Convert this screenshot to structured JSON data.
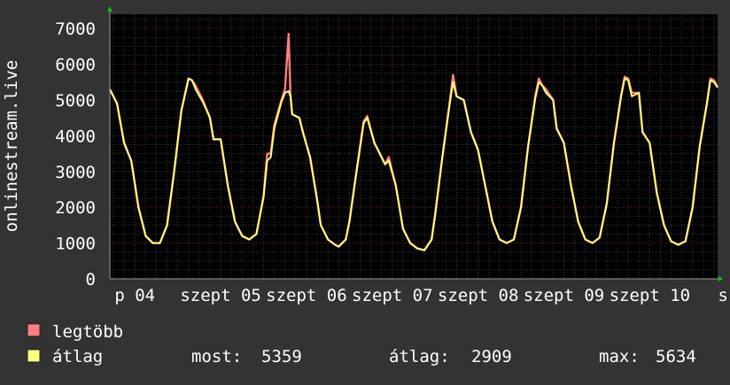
{
  "chart_data": {
    "type": "line",
    "title": "",
    "ylabel": "onlinestream.live",
    "xlabel": "",
    "ylim": [
      0,
      7400
    ],
    "xlim": [
      0,
      170
    ],
    "x_unit_note": "hours since start of window (p 04 00:00 at x=7)",
    "yticks": [
      0,
      1000,
      2000,
      3000,
      4000,
      5000,
      6000,
      7000
    ],
    "x_tick_labels": [
      {
        "x": 7,
        "label": "p 04"
      },
      {
        "x": 31,
        "label": "szept 05"
      },
      {
        "x": 55,
        "label": "szept 06"
      },
      {
        "x": 79,
        "label": "szept 07"
      },
      {
        "x": 103,
        "label": "szept 08"
      },
      {
        "x": 127,
        "label": "szept 09"
      },
      {
        "x": 151,
        "label": "szept 10"
      },
      {
        "x": 175,
        "label": "s"
      }
    ],
    "grid": true,
    "legend_position": "bottom-left",
    "series": [
      {
        "name": "legtöbb",
        "color": "#ff7f7f",
        "points": [
          [
            0,
            5300
          ],
          [
            2,
            4900
          ],
          [
            4,
            3800
          ],
          [
            6,
            3300
          ],
          [
            8,
            2000
          ],
          [
            10,
            1200
          ],
          [
            12,
            1000
          ],
          [
            14,
            1000
          ],
          [
            16,
            1500
          ],
          [
            18,
            3000
          ],
          [
            20,
            4700
          ],
          [
            22,
            5600
          ],
          [
            23,
            5550
          ],
          [
            24,
            5400
          ],
          [
            26,
            5000
          ],
          [
            28,
            4500
          ],
          [
            29,
            3900
          ],
          [
            31,
            3900
          ],
          [
            33,
            2600
          ],
          [
            35,
            1600
          ],
          [
            37,
            1200
          ],
          [
            39,
            1100
          ],
          [
            41,
            1250
          ],
          [
            43,
            2300
          ],
          [
            44,
            3500
          ],
          [
            45,
            3500
          ],
          [
            46,
            4300
          ],
          [
            48,
            5000
          ],
          [
            49,
            5300
          ],
          [
            50,
            6850
          ],
          [
            50.5,
            5200
          ],
          [
            51,
            4600
          ],
          [
            53,
            4500
          ],
          [
            54,
            4100
          ],
          [
            56,
            3400
          ],
          [
            58,
            2200
          ],
          [
            59,
            1500
          ],
          [
            61,
            1100
          ],
          [
            63,
            950
          ],
          [
            64,
            900
          ],
          [
            66,
            1100
          ],
          [
            67,
            1600
          ],
          [
            69,
            3000
          ],
          [
            71,
            4400
          ],
          [
            72,
            4550
          ],
          [
            74,
            3800
          ],
          [
            76,
            3400
          ],
          [
            77,
            3200
          ],
          [
            78,
            3400
          ],
          [
            80,
            2600
          ],
          [
            82,
            1400
          ],
          [
            84,
            1000
          ],
          [
            86,
            850
          ],
          [
            88,
            800
          ],
          [
            90,
            1100
          ],
          [
            91,
            1800
          ],
          [
            93,
            3400
          ],
          [
            95,
            4900
          ],
          [
            96,
            5700
          ],
          [
            97,
            5100
          ],
          [
            99,
            5000
          ],
          [
            101,
            4100
          ],
          [
            103,
            3600
          ],
          [
            105,
            2600
          ],
          [
            107,
            1600
          ],
          [
            109,
            1100
          ],
          [
            111,
            1000
          ],
          [
            113,
            1100
          ],
          [
            115,
            2000
          ],
          [
            117,
            3700
          ],
          [
            119,
            5100
          ],
          [
            120,
            5600
          ],
          [
            121,
            5400
          ],
          [
            122,
            5300
          ],
          [
            124,
            5000
          ],
          [
            125,
            4200
          ],
          [
            127,
            3800
          ],
          [
            129,
            2600
          ],
          [
            131,
            1600
          ],
          [
            133,
            1100
          ],
          [
            135,
            1000
          ],
          [
            137,
            1150
          ],
          [
            139,
            2100
          ],
          [
            141,
            3800
          ],
          [
            143,
            5100
          ],
          [
            144,
            5650
          ],
          [
            145,
            5600
          ],
          [
            146,
            5200
          ],
          [
            148,
            5200
          ],
          [
            149,
            4100
          ],
          [
            151,
            3800
          ],
          [
            153,
            2400
          ],
          [
            155,
            1500
          ],
          [
            157,
            1050
          ],
          [
            159,
            950
          ],
          [
            161,
            1050
          ],
          [
            163,
            2000
          ],
          [
            165,
            3700
          ],
          [
            167,
            4900
          ],
          [
            168,
            5600
          ],
          [
            169,
            5550
          ],
          [
            170,
            5350
          ]
        ]
      },
      {
        "name": "átlag",
        "color": "#ffff7f",
        "points": [
          [
            0,
            5300
          ],
          [
            2,
            4900
          ],
          [
            4,
            3800
          ],
          [
            6,
            3300
          ],
          [
            8,
            2000
          ],
          [
            10,
            1200
          ],
          [
            12,
            1000
          ],
          [
            14,
            1000
          ],
          [
            16,
            1500
          ],
          [
            18,
            3000
          ],
          [
            20,
            4700
          ],
          [
            22,
            5600
          ],
          [
            23,
            5550
          ],
          [
            24,
            5300
          ],
          [
            26,
            4950
          ],
          [
            28,
            4500
          ],
          [
            29,
            3900
          ],
          [
            31,
            3900
          ],
          [
            33,
            2600
          ],
          [
            35,
            1600
          ],
          [
            37,
            1200
          ],
          [
            39,
            1100
          ],
          [
            41,
            1250
          ],
          [
            43,
            2300
          ],
          [
            44,
            3300
          ],
          [
            45,
            3400
          ],
          [
            46,
            4200
          ],
          [
            48,
            4950
          ],
          [
            49,
            5200
          ],
          [
            50,
            5250
          ],
          [
            50.5,
            5100
          ],
          [
            51,
            4600
          ],
          [
            53,
            4500
          ],
          [
            54,
            4100
          ],
          [
            56,
            3400
          ],
          [
            58,
            2200
          ],
          [
            59,
            1500
          ],
          [
            61,
            1100
          ],
          [
            63,
            950
          ],
          [
            64,
            900
          ],
          [
            66,
            1100
          ],
          [
            67,
            1600
          ],
          [
            69,
            3000
          ],
          [
            71,
            4350
          ],
          [
            72,
            4500
          ],
          [
            74,
            3800
          ],
          [
            76,
            3400
          ],
          [
            77,
            3200
          ],
          [
            78,
            3300
          ],
          [
            80,
            2600
          ],
          [
            82,
            1400
          ],
          [
            84,
            1000
          ],
          [
            86,
            850
          ],
          [
            88,
            800
          ],
          [
            90,
            1100
          ],
          [
            91,
            1800
          ],
          [
            93,
            3400
          ],
          [
            95,
            4850
          ],
          [
            96,
            5500
          ],
          [
            97,
            5100
          ],
          [
            99,
            5000
          ],
          [
            101,
            4100
          ],
          [
            103,
            3600
          ],
          [
            105,
            2600
          ],
          [
            107,
            1600
          ],
          [
            109,
            1100
          ],
          [
            111,
            1000
          ],
          [
            113,
            1100
          ],
          [
            115,
            2000
          ],
          [
            117,
            3700
          ],
          [
            119,
            5050
          ],
          [
            120,
            5500
          ],
          [
            121,
            5400
          ],
          [
            122,
            5200
          ],
          [
            124,
            5000
          ],
          [
            125,
            4200
          ],
          [
            127,
            3800
          ],
          [
            129,
            2600
          ],
          [
            131,
            1600
          ],
          [
            133,
            1100
          ],
          [
            135,
            1000
          ],
          [
            137,
            1150
          ],
          [
            139,
            2100
          ],
          [
            141,
            3800
          ],
          [
            143,
            5100
          ],
          [
            144,
            5600
          ],
          [
            145,
            5550
          ],
          [
            146,
            5100
          ],
          [
            148,
            5200
          ],
          [
            149,
            4100
          ],
          [
            151,
            3800
          ],
          [
            153,
            2400
          ],
          [
            155,
            1500
          ],
          [
            157,
            1050
          ],
          [
            159,
            950
          ],
          [
            161,
            1050
          ],
          [
            163,
            2000
          ],
          [
            165,
            3700
          ],
          [
            167,
            4900
          ],
          [
            168,
            5550
          ],
          [
            169,
            5500
          ],
          [
            170,
            5350
          ]
        ]
      }
    ],
    "legend": [
      {
        "name": "legtöbb",
        "color": "#ff7f7f"
      },
      {
        "name": "átlag",
        "color": "#ffff7f"
      }
    ],
    "stats": {
      "most_label": "most:",
      "most_value": "5359",
      "avg_label": "átlag:",
      "avg_value": "2909",
      "max_label": "max:",
      "max_value": "5634"
    }
  }
}
